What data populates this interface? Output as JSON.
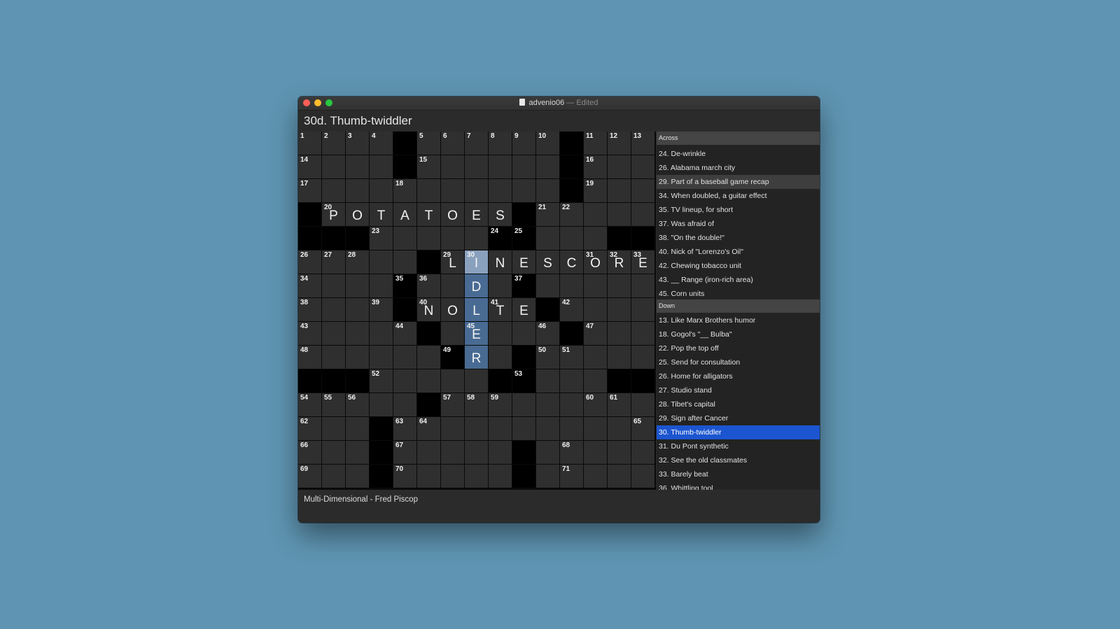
{
  "window": {
    "filename": "advenio06",
    "edited_label": " — Edited"
  },
  "current_clue": "30d. Thumb-twiddler",
  "footer": "Multi-Dimensional - Fred Piscop",
  "grid": {
    "rows": [
      "....#......#...",
      "....#......#...",
      "...........#...",
      "#........#.....",
      "###.....##...##",
      ".....#.........",
      "....#....#.....",
      "....#.....#....",
      ".....#.....#...",
      "......#..#.....",
      "###.....##...##",
      ".....#.........",
      "...#...........",
      "...#.....#.....",
      "...#.....#....."
    ],
    "numbers": [
      [
        0,
        0,
        "1"
      ],
      [
        0,
        1,
        "2"
      ],
      [
        0,
        2,
        "3"
      ],
      [
        0,
        3,
        "4"
      ],
      [
        0,
        5,
        "5"
      ],
      [
        0,
        6,
        "6"
      ],
      [
        0,
        7,
        "7"
      ],
      [
        0,
        8,
        "8"
      ],
      [
        0,
        9,
        "9"
      ],
      [
        0,
        10,
        "10"
      ],
      [
        0,
        12,
        "11"
      ],
      [
        0,
        13,
        "12"
      ],
      [
        0,
        14,
        "13"
      ],
      [
        1,
        0,
        "14"
      ],
      [
        1,
        5,
        "15"
      ],
      [
        1,
        12,
        "16"
      ],
      [
        2,
        0,
        "17"
      ],
      [
        2,
        4,
        "18"
      ],
      [
        2,
        12,
        "19"
      ],
      [
        3,
        1,
        "20"
      ],
      [
        3,
        10,
        "21"
      ],
      [
        3,
        11,
        "22"
      ],
      [
        4,
        3,
        "23"
      ],
      [
        4,
        8,
        "24"
      ],
      [
        4,
        9,
        "25"
      ],
      [
        5,
        0,
        "26"
      ],
      [
        5,
        1,
        "27"
      ],
      [
        5,
        2,
        "28"
      ],
      [
        5,
        6,
        "29"
      ],
      [
        5,
        7,
        "30"
      ],
      [
        5,
        12,
        "31"
      ],
      [
        5,
        13,
        "32"
      ],
      [
        5,
        14,
        "33"
      ],
      [
        6,
        0,
        "34"
      ],
      [
        6,
        4,
        "35"
      ],
      [
        6,
        5,
        "36"
      ],
      [
        6,
        9,
        "37"
      ],
      [
        7,
        0,
        "38"
      ],
      [
        7,
        3,
        "39"
      ],
      [
        7,
        5,
        "40"
      ],
      [
        7,
        8,
        "41"
      ],
      [
        7,
        11,
        "42"
      ],
      [
        8,
        0,
        "43"
      ],
      [
        8,
        4,
        "44"
      ],
      [
        8,
        7,
        "45"
      ],
      [
        8,
        10,
        "46"
      ],
      [
        8,
        12,
        "47"
      ],
      [
        9,
        0,
        "48"
      ],
      [
        9,
        6,
        "49"
      ],
      [
        9,
        10,
        "50"
      ],
      [
        9,
        11,
        "51"
      ],
      [
        10,
        3,
        "52"
      ],
      [
        10,
        9,
        "53"
      ],
      [
        11,
        0,
        "54"
      ],
      [
        11,
        1,
        "55"
      ],
      [
        11,
        2,
        "56"
      ],
      [
        11,
        6,
        "57"
      ],
      [
        11,
        7,
        "58"
      ],
      [
        11,
        8,
        "59"
      ],
      [
        11,
        12,
        "60"
      ],
      [
        11,
        13,
        "61"
      ],
      [
        12,
        0,
        "62"
      ],
      [
        12,
        4,
        "63"
      ],
      [
        12,
        5,
        "64"
      ],
      [
        12,
        14,
        "65"
      ],
      [
        13,
        0,
        "66"
      ],
      [
        13,
        4,
        "67"
      ],
      [
        13,
        11,
        "68"
      ],
      [
        14,
        0,
        "69"
      ],
      [
        14,
        4,
        "70"
      ],
      [
        14,
        11,
        "71"
      ]
    ],
    "letters": [
      [
        3,
        1,
        "P"
      ],
      [
        3,
        2,
        "O"
      ],
      [
        3,
        3,
        "T"
      ],
      [
        3,
        4,
        "A"
      ],
      [
        3,
        5,
        "T"
      ],
      [
        3,
        6,
        "O"
      ],
      [
        3,
        7,
        "E"
      ],
      [
        3,
        8,
        "S"
      ],
      [
        5,
        6,
        "L"
      ],
      [
        5,
        7,
        "I"
      ],
      [
        5,
        8,
        "N"
      ],
      [
        5,
        9,
        "E"
      ],
      [
        5,
        10,
        "S"
      ],
      [
        5,
        11,
        "C"
      ],
      [
        5,
        12,
        "O"
      ],
      [
        5,
        13,
        "R"
      ],
      [
        5,
        14,
        "E"
      ],
      [
        6,
        7,
        "D"
      ],
      [
        7,
        5,
        "N"
      ],
      [
        7,
        6,
        "O"
      ],
      [
        7,
        7,
        "L"
      ],
      [
        7,
        8,
        "T"
      ],
      [
        7,
        9,
        "E"
      ],
      [
        8,
        7,
        "E"
      ],
      [
        9,
        7,
        "R"
      ]
    ],
    "highlight_cells": [
      [
        6,
        7
      ],
      [
        7,
        7
      ],
      [
        8,
        7
      ],
      [
        9,
        7
      ]
    ],
    "current_cell": [
      5,
      7
    ]
  },
  "clues": {
    "across_heading": "Across",
    "across": [
      "24. De-wrinkle",
      "26. Alabama march city",
      "29. Part of a baseball game recap",
      "34. When doubled, a guitar effect",
      "35. TV lineup, for short",
      "37. Was afraid of",
      "38. \"On the double!\"",
      "40. Nick of \"Lorenzo's Oil\"",
      "42. Chewing tobacco unit",
      "43. __ Range (iron-rich area)",
      "45. Corn units"
    ],
    "across_selected_index": 2,
    "down_heading": "Down",
    "down": [
      "13. Like Marx Brothers humor",
      "18. Gogol's \"__ Bulba\"",
      "22. Pop the top off",
      "25. Send for consultation",
      "26. Home for alligators",
      "27. Studio stand",
      "28. Tibet's capital",
      "29. Sign after Cancer",
      "30. Thumb-twiddler",
      "31. Du Pont synthetic",
      "32. See the old classmates",
      "33. Barely beat",
      "36. Whittling tool"
    ],
    "down_selected_index": 8
  }
}
